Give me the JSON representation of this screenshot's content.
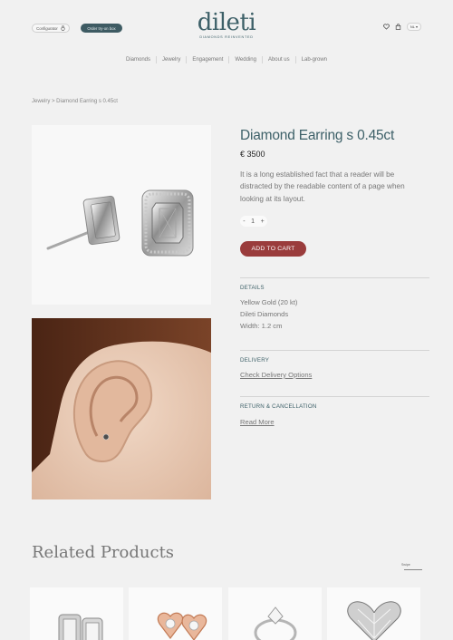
{
  "header": {
    "configurator_label": "Configurator",
    "tryon_label": "Order try-on box",
    "logo_text": "dileti",
    "logo_tagline": "DIAMONDS REINVENTED",
    "lang": "NL ▾"
  },
  "nav": [
    "Diamonds",
    "Jewelry",
    "Engagement",
    "Wedding",
    "About us",
    "Lab-grown"
  ],
  "breadcrumb": "Jewelry > Diamond Earring s 0.45ct",
  "product": {
    "title": "Diamond Earring s 0.45ct",
    "price": "€ 3500",
    "description": "It is a long established fact that a reader will be distracted by the readable content of a page when looking at its layout.",
    "qty_minus": "-",
    "qty_value": "1",
    "qty_plus": "+",
    "add_to_cart": "ADD TO CART"
  },
  "details": {
    "title": "DETAILS",
    "lines": [
      "Yellow Gold (20 kt)",
      "Dileti Diamonds",
      "Width: 1.2 cm"
    ]
  },
  "delivery": {
    "title": "DELIVERY",
    "link": "Check Delivery Options"
  },
  "returns": {
    "title": "RETURN & CANCELLATION",
    "link": "Read More"
  },
  "related": {
    "title": "Related Products",
    "swipe_label": "Swipe"
  },
  "colors": {
    "accent": "#3d6068",
    "cta": "#9a3c3c",
    "background": "#f1f1f1"
  }
}
